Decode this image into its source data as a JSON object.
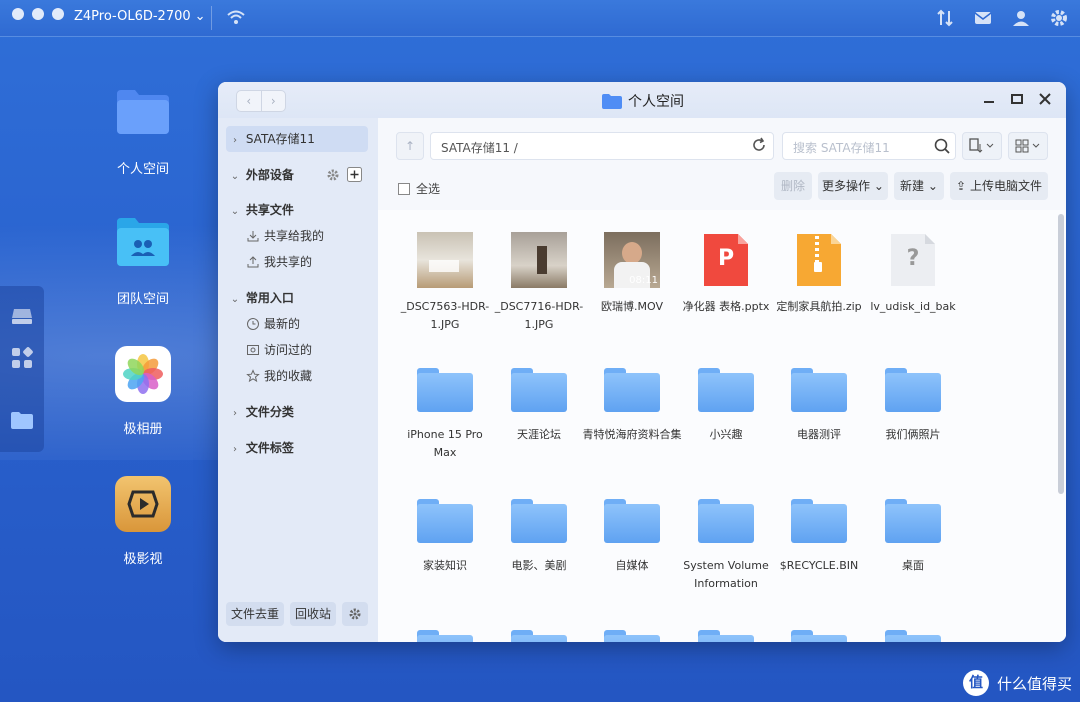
{
  "topbar": {
    "device_name": "Z4Pro-OL6D-2700"
  },
  "desktop": {
    "items": [
      {
        "label": "个人空间"
      },
      {
        "label": "团队空间"
      },
      {
        "label": "极相册"
      },
      {
        "label": "极影视"
      }
    ]
  },
  "window": {
    "title": "个人空间",
    "sidebar": {
      "storage": "SATA存储11",
      "external": "外部设备",
      "shared_header": "共享文件",
      "shared_items": [
        "共享给我的",
        "我共享的"
      ],
      "common_header": "常用入口",
      "common_items": [
        "最新的",
        "访问过的",
        "我的收藏"
      ],
      "category": "文件分类",
      "tags": "文件标签",
      "bottom": {
        "dedupe": "文件去重",
        "recycle": "回收站"
      }
    },
    "toolbar": {
      "path": "SATA存储11 /",
      "search_placeholder": "搜索 SATA存储11",
      "select_all": "全选",
      "delete": "删除",
      "more": "更多操作",
      "new": "新建",
      "upload": "上传电脑文件"
    },
    "files": [
      {
        "name": "_DSC7563-HDR-1.JPG",
        "type": "image"
      },
      {
        "name": "_DSC7716-HDR-1.JPG",
        "type": "image"
      },
      {
        "name": "欧瑞博.MOV",
        "type": "video",
        "duration": "08:11"
      },
      {
        "name": "净化器 表格.pptx",
        "type": "pptx",
        "glyph": "P"
      },
      {
        "name": "定制家具航拍.zip",
        "type": "zip"
      },
      {
        "name": "lv_udisk_id_bak",
        "type": "unknown",
        "glyph": "?"
      },
      {
        "name": "iPhone 15 Pro Max",
        "type": "folder"
      },
      {
        "name": "天涯论坛",
        "type": "folder"
      },
      {
        "name": "青特悦海府资料合集",
        "type": "folder"
      },
      {
        "name": "小兴趣",
        "type": "folder"
      },
      {
        "name": "电器测评",
        "type": "folder"
      },
      {
        "name": "我们俩照片",
        "type": "folder"
      },
      {
        "name": "家装知识",
        "type": "folder"
      },
      {
        "name": "电影、美剧",
        "type": "folder"
      },
      {
        "name": "自媒体",
        "type": "folder"
      },
      {
        "name": "System Volume Information",
        "type": "folder"
      },
      {
        "name": "$RECYCLE.BIN",
        "type": "folder"
      },
      {
        "name": "桌面",
        "type": "folder"
      }
    ]
  },
  "watermark": {
    "logo": "值",
    "text": "什么值得买"
  }
}
